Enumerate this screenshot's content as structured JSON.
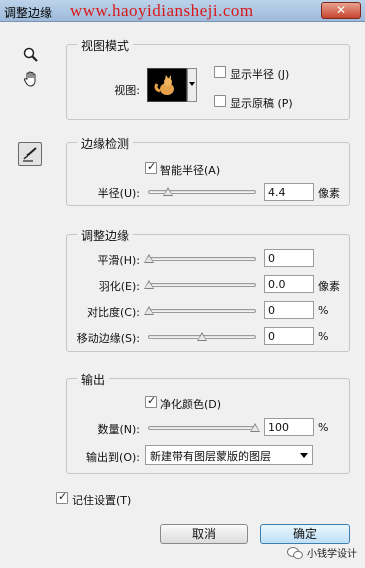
{
  "window": {
    "title": "调整边缘",
    "watermark": "www.haoyidiansheji.com",
    "close_symbol": "✕"
  },
  "tools": [
    {
      "name": "zoom",
      "icon": "zoom-magnifier-icon"
    },
    {
      "name": "hand",
      "icon": "hand-icon"
    },
    {
      "name": "refine-radius",
      "icon": "refine-radius-brush-icon"
    }
  ],
  "view_mode": {
    "legend": "视图模式",
    "view_label": "视图:",
    "show_radius_label": "显示半径 (J)",
    "show_radius_checked": false,
    "show_original_label": "显示原稿 (P)",
    "show_original_checked": false
  },
  "edge_detection": {
    "legend": "边缘检测",
    "smart_radius_label": "智能半径(A)",
    "smart_radius_checked": true,
    "radius_label": "半径(U):",
    "radius_value": "4.4",
    "radius_unit": "像素",
    "radius_slider_fraction": 0.18
  },
  "adjust_edge": {
    "legend": "调整边缘",
    "smooth_label": "平滑(H):",
    "smooth_value": "0",
    "smooth_fraction": 0.0,
    "feather_label": "羽化(E):",
    "feather_value": "0.0",
    "feather_unit": "像素",
    "feather_fraction": 0.0,
    "contrast_label": "对比度(C):",
    "contrast_value": "0",
    "contrast_unit": "%",
    "contrast_fraction": 0.0,
    "shift_edge_label": "移动边缘(S):",
    "shift_edge_value": "0",
    "shift_edge_unit": "%",
    "shift_edge_fraction": 0.5
  },
  "output": {
    "legend": "输出",
    "decontaminate_label": "净化颜色(D)",
    "decontaminate_checked": true,
    "amount_label": "数量(N):",
    "amount_value": "100",
    "amount_unit": "%",
    "amount_fraction": 1.0,
    "output_to_label": "输出到(O):",
    "output_to_value": "新建带有图层蒙版的图层"
  },
  "remember": {
    "label": "记住设置(T)",
    "checked": true
  },
  "buttons": {
    "cancel": "取消",
    "ok": "确定"
  },
  "footer": {
    "brand": "小钱学设计"
  },
  "colors": {
    "watermark": "#d81818",
    "primary_button": "#bfe0f7"
  }
}
